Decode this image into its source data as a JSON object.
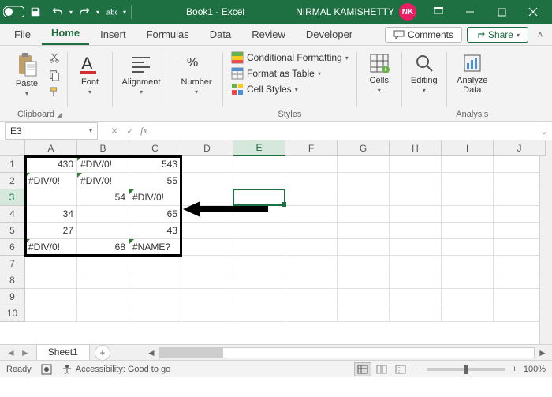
{
  "title": "Book1 - Excel",
  "user": {
    "name": "NIRMAL KAMISHETTY",
    "initials": "NK"
  },
  "qat": {
    "autosave": "AutoSave",
    "save": "Save",
    "undo": "Undo",
    "redo": "Redo"
  },
  "tabs": [
    "File",
    "Home",
    "Insert",
    "Formulas",
    "Data",
    "Review",
    "Developer"
  ],
  "activeTab": "Home",
  "ribbonActions": {
    "comments": "Comments",
    "share": "Share"
  },
  "ribbon": {
    "clipboard": {
      "label": "Clipboard",
      "paste": "Paste"
    },
    "font": {
      "label": "Font",
      "btn": "Font"
    },
    "alignment": {
      "label": "Alignment",
      "btn": "Alignment"
    },
    "number": {
      "label": "Number",
      "btn": "Number"
    },
    "styles": {
      "label": "Styles",
      "cond": "Conditional Formatting",
      "table": "Format as Table",
      "cell": "Cell Styles"
    },
    "cells": {
      "label": "Cells",
      "btn": "Cells"
    },
    "editing": {
      "label": "Editing",
      "btn": "Editing"
    },
    "analysis": {
      "label": "Analysis",
      "btn": "Analyze Data"
    }
  },
  "namebox": "E3",
  "formula": "",
  "columns": [
    "A",
    "B",
    "C",
    "D",
    "E",
    "F",
    "G",
    "H",
    "I",
    "J"
  ],
  "activeCol": 4,
  "rows": [
    1,
    2,
    3,
    4,
    5,
    6,
    7,
    8,
    9,
    10
  ],
  "activeRow": 2,
  "gridData": [
    [
      {
        "v": "430",
        "a": "r"
      },
      {
        "v": "#DIV/0!",
        "a": "l",
        "e": true
      },
      {
        "v": "543",
        "a": "r"
      }
    ],
    [
      {
        "v": "#DIV/0!",
        "a": "l",
        "e": true
      },
      {
        "v": "#DIV/0!",
        "a": "l",
        "e": true
      },
      {
        "v": "55",
        "a": "r"
      }
    ],
    [
      {
        "v": "",
        "a": "r"
      },
      {
        "v": "54",
        "a": "r"
      },
      {
        "v": "#DIV/0!",
        "a": "l",
        "e": true
      }
    ],
    [
      {
        "v": "34",
        "a": "r"
      },
      {
        "v": "",
        "a": "r"
      },
      {
        "v": "65",
        "a": "r"
      }
    ],
    [
      {
        "v": "27",
        "a": "r"
      },
      {
        "v": "",
        "a": "r"
      },
      {
        "v": "43",
        "a": "r"
      }
    ],
    [
      {
        "v": "#DIV/0!",
        "a": "l",
        "e": true
      },
      {
        "v": "68",
        "a": "r"
      },
      {
        "v": "#NAME?",
        "a": "l",
        "e": true
      }
    ]
  ],
  "sheet": {
    "name": "Sheet1"
  },
  "status": {
    "ready": "Ready",
    "access": "Accessibility: Good to go",
    "zoom": "100%"
  }
}
